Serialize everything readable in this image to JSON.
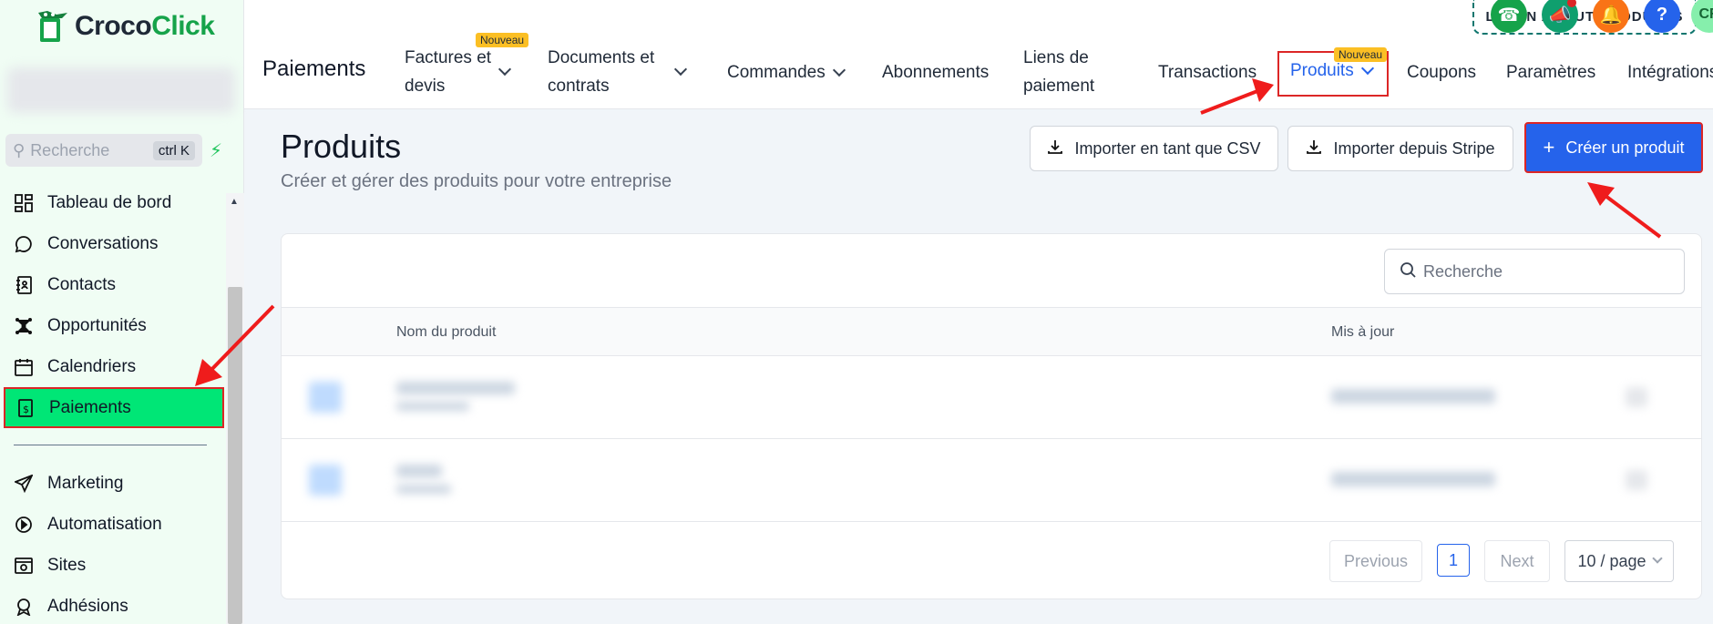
{
  "brand": {
    "name_part1": "Croco",
    "name_part2": "Click"
  },
  "sidebar": {
    "search_placeholder": "Recherche",
    "search_shortcut": "ctrl K",
    "items": [
      {
        "label": "Tableau de bord",
        "icon": "dashboard-icon"
      },
      {
        "label": "Conversations",
        "icon": "chat-bubble-icon"
      },
      {
        "label": "Contacts",
        "icon": "address-book-icon"
      },
      {
        "label": "Opportunités",
        "icon": "network-icon"
      },
      {
        "label": "Calendriers",
        "icon": "calendar-icon"
      },
      {
        "label": "Paiements",
        "icon": "payments-icon",
        "active": true
      }
    ],
    "items2": [
      {
        "label": "Marketing",
        "icon": "send-icon"
      },
      {
        "label": "Automatisation",
        "icon": "automation-icon"
      },
      {
        "label": "Sites",
        "icon": "website-icon"
      },
      {
        "label": "Adhésions",
        "icon": "badge-icon"
      }
    ]
  },
  "header": {
    "learn_button": "LEARN ABOUT PRODUCTS",
    "avatar_initials": "CR",
    "help_symbol": "?",
    "page_name": "Paiements",
    "tabs": [
      {
        "label_line1": "Factures et",
        "label_line2": "devis",
        "badge": "Nouveau"
      },
      {
        "label_line1": "Documents et",
        "label_line2": "contrats"
      },
      {
        "label": "Commandes"
      },
      {
        "label": "Abonnements"
      },
      {
        "label_line1": "Liens de",
        "label_line2": "paiement"
      },
      {
        "label": "Transactions"
      },
      {
        "label": "Produits",
        "badge": "Nouveau",
        "active": true
      },
      {
        "label": "Coupons"
      },
      {
        "label": "Paramètres"
      },
      {
        "label": "Intégrations"
      }
    ]
  },
  "main": {
    "title": "Produits",
    "subtitle": "Créer et gérer des produits pour votre entreprise",
    "import_csv": "Importer en tant que CSV",
    "import_stripe": "Importer depuis Stripe",
    "create_product": "Créer un produit",
    "search_placeholder": "Recherche",
    "columns": {
      "name": "Nom du produit",
      "updated": "Mis à jour"
    },
    "pagination": {
      "previous": "Previous",
      "page": "1",
      "next": "Next",
      "page_size": "10 / page"
    }
  },
  "colors": {
    "accent": "#2563eb",
    "active_nav": "#00e676",
    "highlight": "#dc2626"
  }
}
